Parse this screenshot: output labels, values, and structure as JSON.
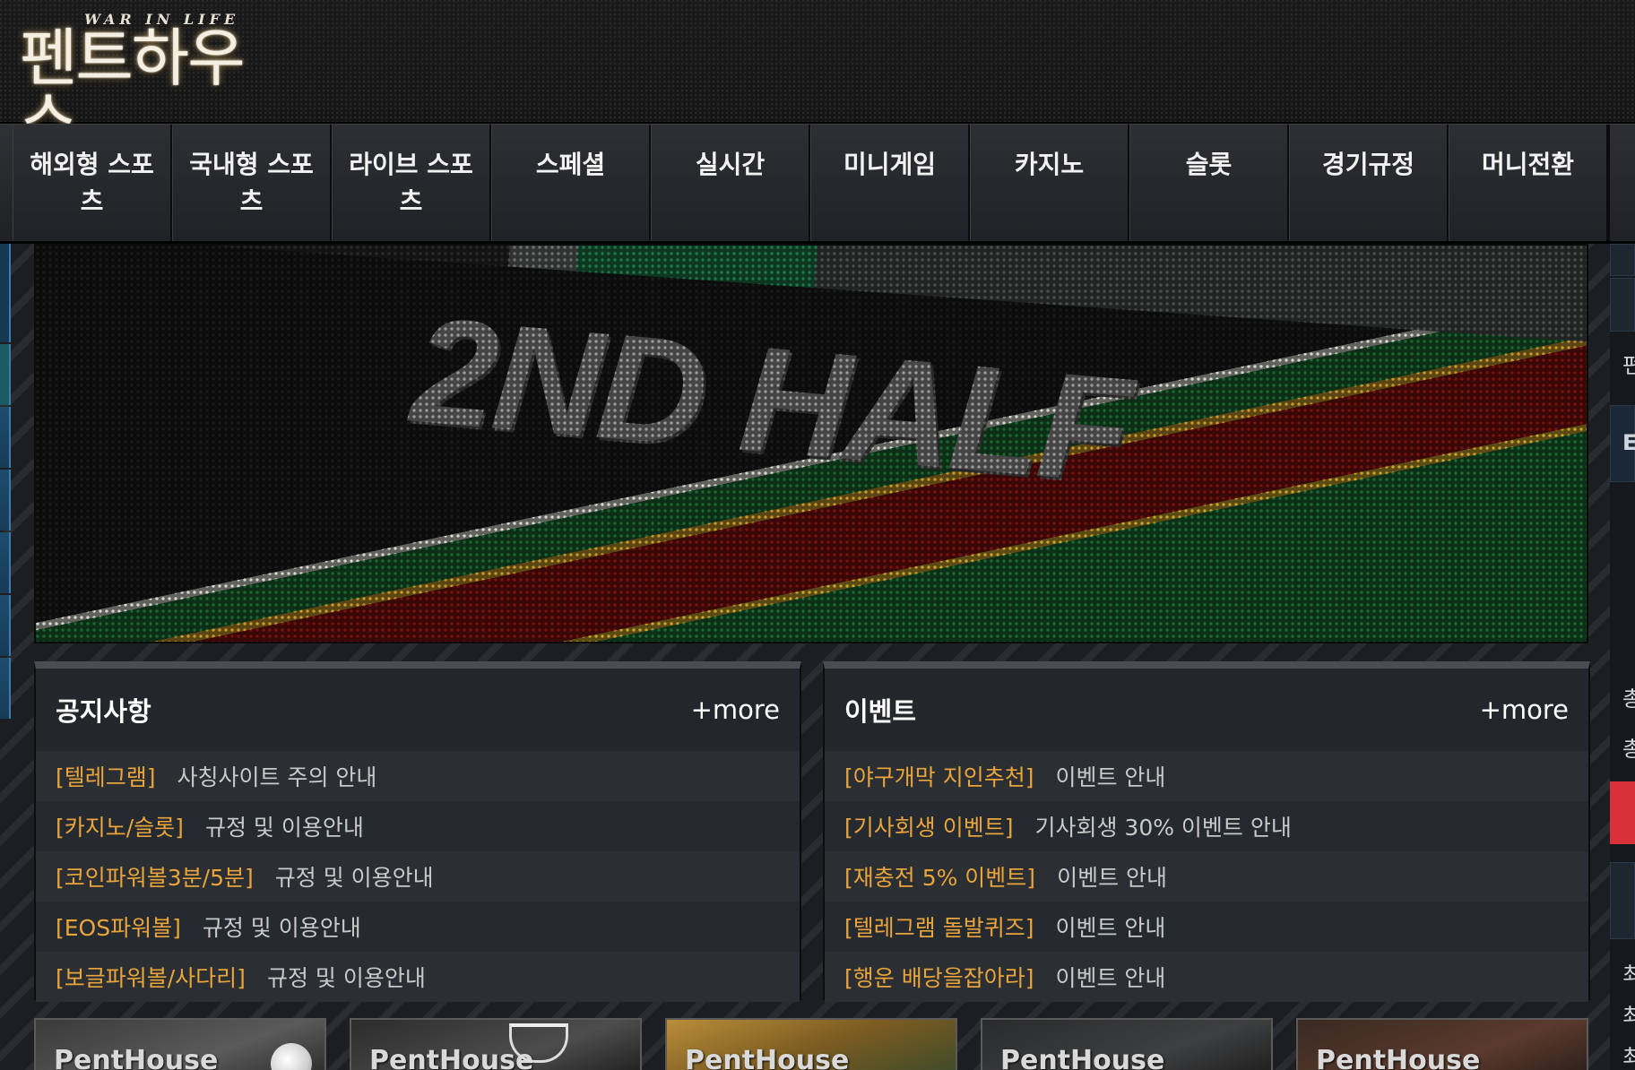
{
  "header": {
    "logo_tagline": "WAR IN LIFE",
    "logo_name": "펜트하우스"
  },
  "nav": {
    "items": [
      {
        "label": "해외형 스포츠"
      },
      {
        "label": "국내형 스포츠"
      },
      {
        "label": "라이브 스포츠"
      },
      {
        "label": "스페셜"
      },
      {
        "label": "실시간"
      },
      {
        "label": "미니게임"
      },
      {
        "label": "카지노"
      },
      {
        "label": "슬롯"
      },
      {
        "label": "경기규정"
      },
      {
        "label": "머니전환"
      }
    ]
  },
  "banner": {
    "title": "2ND HALF"
  },
  "notice": {
    "title": "공지사항",
    "more": "+more",
    "rows": [
      {
        "tag": "[텔레그램]",
        "text": "사칭사이트 주의 안내"
      },
      {
        "tag": "[카지노/슬롯]",
        "text": "규정 및 이용안내"
      },
      {
        "tag": "[코인파워볼3분/5분]",
        "text": "규정 및 이용안내"
      },
      {
        "tag": "[EOS파워볼]",
        "text": "규정 및 이용안내"
      },
      {
        "tag": "[보글파워볼/사다리]",
        "text": "규정 및 이용안내"
      }
    ]
  },
  "event": {
    "title": "이벤트",
    "more": "+more",
    "rows": [
      {
        "tag": "[야구개막 지인추천]",
        "text": "이벤트 안내"
      },
      {
        "tag": "[기사회생 이벤트]",
        "text": "기사회생 30% 이벤트 안내"
      },
      {
        "tag": "[재충전 5% 이벤트]",
        "text": "이벤트 안내"
      },
      {
        "tag": "[텔레그램 돌발퀴즈]",
        "text": "이벤트 안내"
      },
      {
        "tag": "[행운 배당을잡아라]",
        "text": "이벤트 안내"
      }
    ]
  },
  "tiles": [
    {
      "label": "PentHouse"
    },
    {
      "label": "PentHouse"
    },
    {
      "label": "PentHouse"
    },
    {
      "label": "PentHouse"
    },
    {
      "label": "PentHouse"
    }
  ],
  "right_strip": {
    "chars": [
      "펀",
      "E",
      "총",
      "총",
      "최",
      "최",
      "최"
    ]
  },
  "colors": {
    "accent_tag": "#e9a43a",
    "panel_bg": "#23262b",
    "nav_bg": "#26282b"
  }
}
